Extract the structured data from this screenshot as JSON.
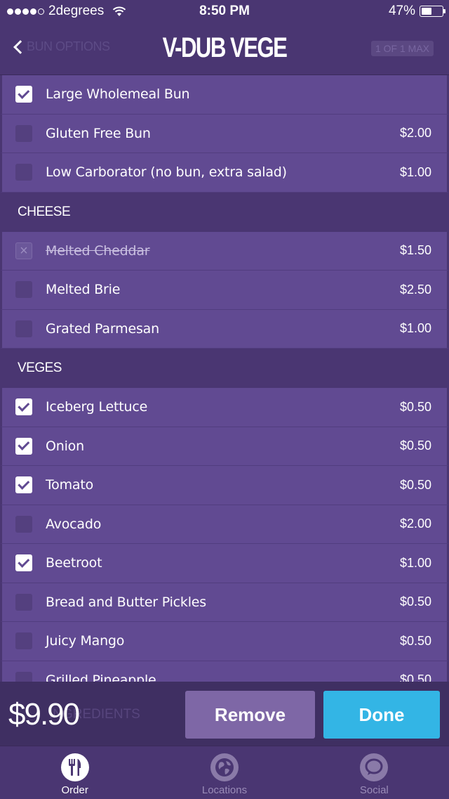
{
  "status_bar": {
    "carrier": "2degrees",
    "time": "8:50 PM",
    "battery": "47%"
  },
  "nav": {
    "back_label": "BUN OPTIONS",
    "title": "V-DUB VEGE",
    "badge": "1 OF 1 MAX"
  },
  "bun_rows": [
    {
      "name": "Large Wholemeal Bun",
      "price": "",
      "state": "checked"
    },
    {
      "name": "Gluten Free Bun",
      "price": "$2.00",
      "state": "unchecked"
    },
    {
      "name": "Low Carborator (no bun, extra salad)",
      "price": "$1.00",
      "state": "unchecked"
    }
  ],
  "sections": {
    "cheese": "CHEESE",
    "veges": "VEGES"
  },
  "cheese_rows": [
    {
      "name": "Melted Cheddar",
      "price": "$1.50",
      "state": "removed"
    },
    {
      "name": "Melted Brie",
      "price": "$2.50",
      "state": "unchecked"
    },
    {
      "name": "Grated Parmesan",
      "price": "$1.00",
      "state": "unchecked"
    }
  ],
  "vege_rows": [
    {
      "name": "Iceberg Lettuce",
      "price": "$0.50",
      "state": "checked"
    },
    {
      "name": "Onion",
      "price": "$0.50",
      "state": "checked"
    },
    {
      "name": "Tomato",
      "price": "$0.50",
      "state": "checked"
    },
    {
      "name": "Avocado",
      "price": "$2.00",
      "state": "unchecked"
    },
    {
      "name": "Beetroot",
      "price": "$1.00",
      "state": "checked"
    },
    {
      "name": "Bread and Butter Pickles",
      "price": "$0.50",
      "state": "unchecked"
    },
    {
      "name": "Juicy Mango",
      "price": "$0.50",
      "state": "unchecked"
    },
    {
      "name": "Grilled Pineapple",
      "price": "$0.50",
      "state": "unchecked"
    }
  ],
  "footer": {
    "total": "$9.90",
    "ghost_section": "INGREDIENTS",
    "remove_label": "Remove",
    "done_label": "Done"
  },
  "tabs": [
    {
      "label": "Order",
      "icon": "fork-knife-icon",
      "active": true
    },
    {
      "label": "Locations",
      "icon": "globe-icon",
      "active": false
    },
    {
      "label": "Social",
      "icon": "chat-bubble-icon",
      "active": false
    }
  ],
  "colors": {
    "background": "#4a3672",
    "row": "#614a92",
    "done_button": "#33b5e5",
    "remove_button": "#7e67a6"
  }
}
